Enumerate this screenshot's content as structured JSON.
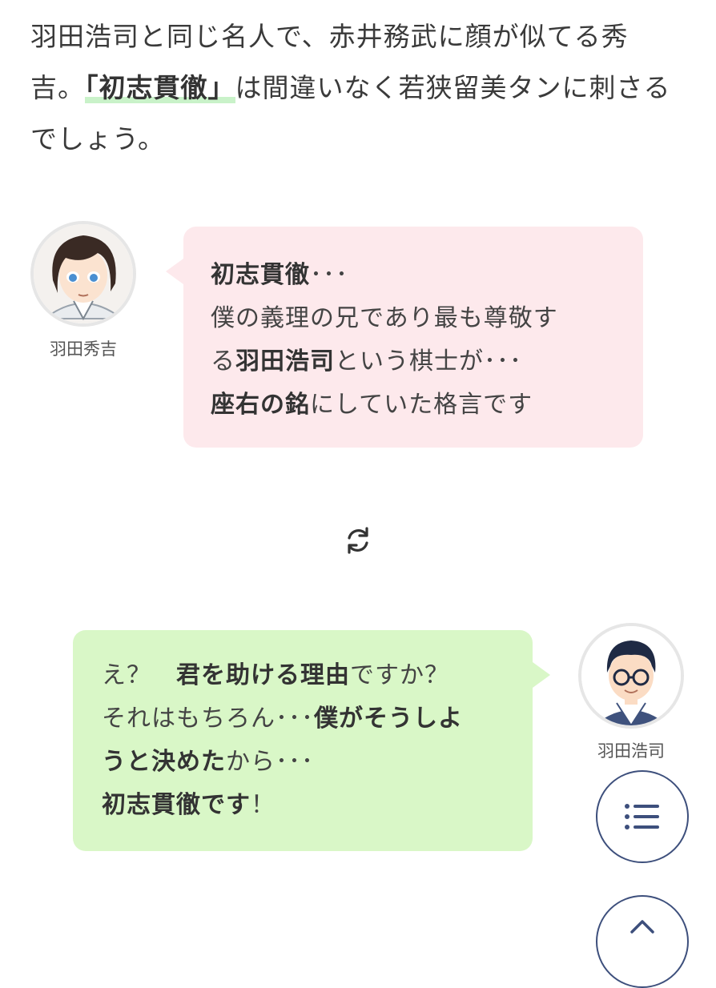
{
  "intro": {
    "part1": "羽田浩司と同じ名人で、赤井務武に顔が似てる秀吉。",
    "highlight": "「初志貫徹」",
    "part2": "は間違いなく若狭留美タンに刺さるでしょう。"
  },
  "dialog1": {
    "speaker": "羽田秀吉",
    "lines": [
      {
        "bold": "初志貫徹",
        "text": "･･･"
      },
      {
        "text": "僕の義理の兄であり最も尊敬す"
      },
      {
        "pre": "る",
        "bold": "羽田浩司",
        "text": "という棋士が･･･"
      },
      {
        "bold": "座右の銘",
        "text": "にしていた格言です"
      }
    ]
  },
  "dialog2": {
    "speaker": "羽田浩司",
    "lines": [
      {
        "pre": "え？　",
        "bold": "君を助ける理由",
        "text": "ですか？"
      },
      {
        "pre": "それはもちろん･･･",
        "bold": "僕がそうしよ"
      },
      {
        "bold": "うと決めた",
        "text": "から･･･"
      },
      {
        "bold": "初志貫徹です",
        "text": "！"
      }
    ]
  },
  "icons": {
    "swap": "refresh-arrows-icon",
    "toc": "list-icon",
    "top": "chevron-up-icon"
  },
  "colors": {
    "pink_bubble": "#fde9ec",
    "green_bubble": "#d9f7c7",
    "highlight": "#c9f2c9",
    "fab_border": "#3d4f7c"
  }
}
